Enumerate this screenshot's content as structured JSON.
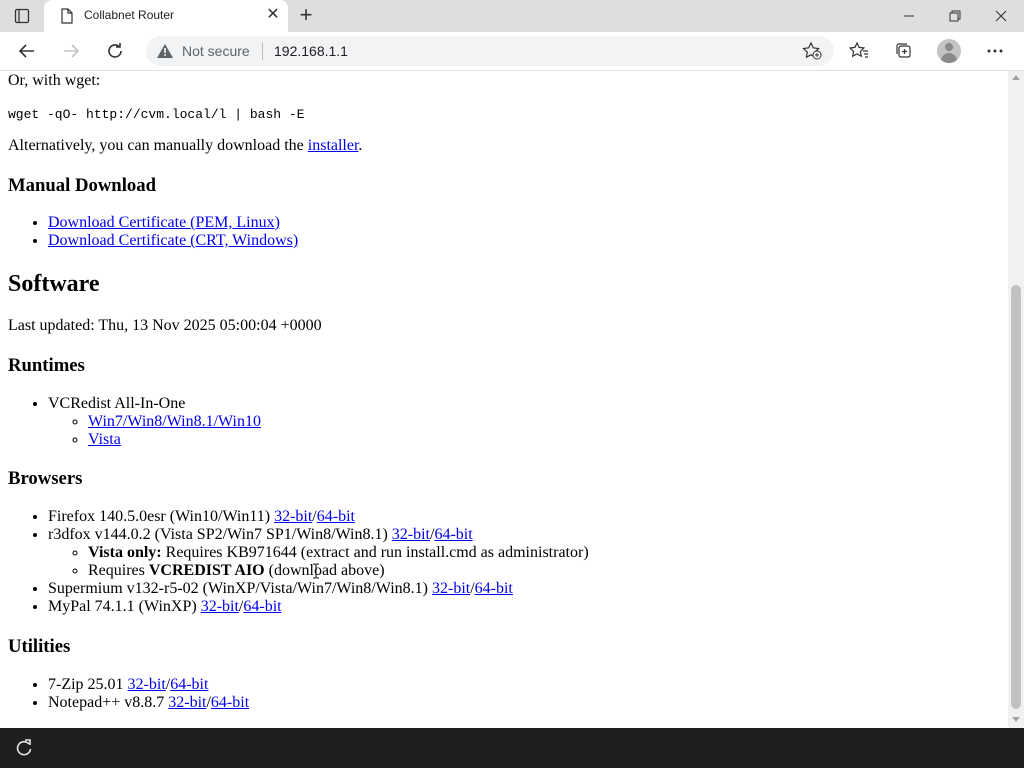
{
  "browser": {
    "tab_title": "Collabnet Router",
    "security_label": "Not secure",
    "url": "192.168.1.1"
  },
  "page": {
    "wget_intro": "Or, with wget:",
    "wget_cmd": "wget -qO- http://cvm.local/l | bash -E",
    "alt_prefix": "Alternatively, you can manually download the ",
    "alt_link": "installer",
    "alt_suffix": ".",
    "manual_heading": "Manual Download",
    "cert_pem": "Download Certificate (PEM, Linux)",
    "cert_crt": "Download Certificate (CRT, Windows)",
    "software_heading": "Software",
    "last_updated": "Last updated: Thu, 13 Nov 2025 05:00:04 +0000",
    "runtimes_heading": "Runtimes",
    "vcredist_label": "VCRedist All-In-One",
    "vcredist_win": "Win7/Win8/Win8.1/Win10",
    "vcredist_vista": "Vista",
    "browsers_heading": "Browsers",
    "firefox_label": "Firefox 140.5.0esr (Win10/Win11) ",
    "r3dfox_label": "r3dfox v144.0.2 (Vista SP2/Win7 SP1/Win8/Win8.1) ",
    "vista_only_bold": "Vista only:",
    "vista_only_text": " Requires KB971644 (extract and run install.cmd as administrator)",
    "requires_prefix": "Requires ",
    "requires_bold": "VCREDIST AIO",
    "requires_suffix": " (download above)",
    "supermium_label": "Supermium v132-r5-02 (WinXP/Vista/Win7/Win8/Win8.1) ",
    "mypal_label": "MyPal 74.1.1 (WinXP) ",
    "utilities_heading": "Utilities",
    "sevenzip_label": "7-Zip 25.01 ",
    "notepad_label": "Notepad++ v8.8.7 ",
    "link_32": "32-bit",
    "link_sep": "/",
    "link_64": "64-bit"
  }
}
